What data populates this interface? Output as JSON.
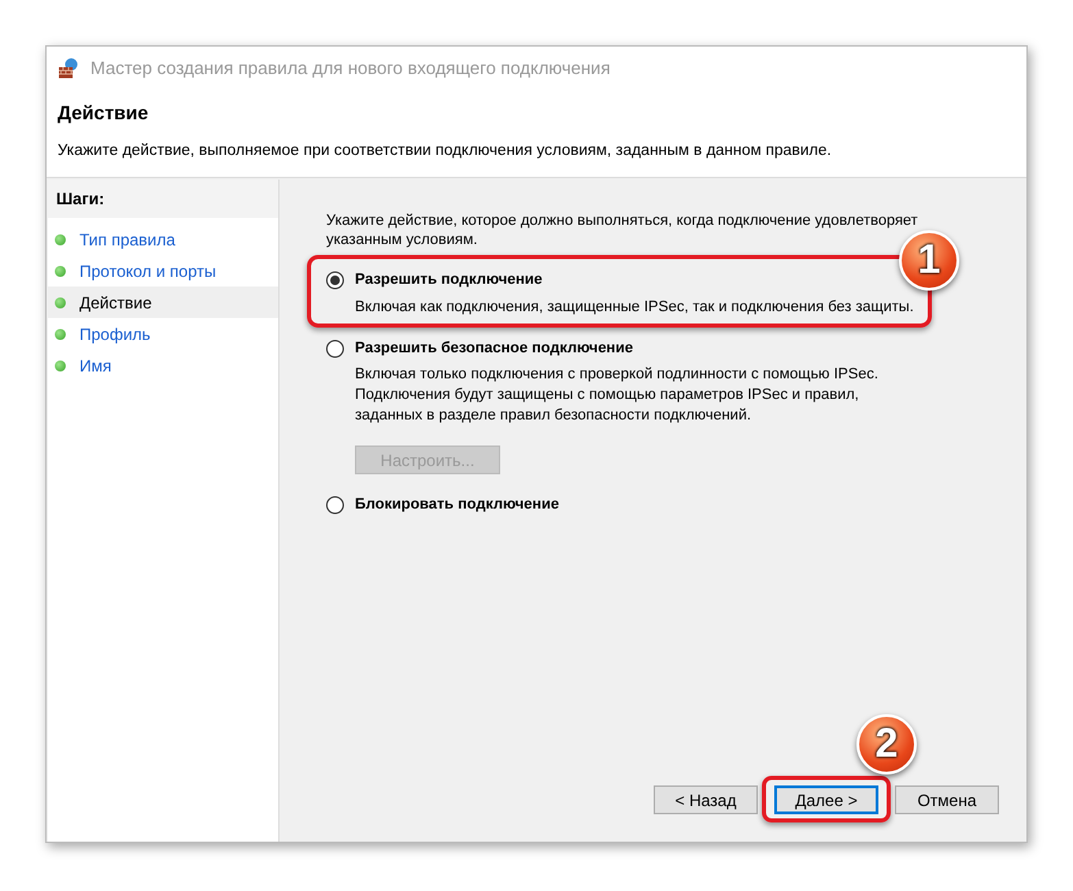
{
  "window": {
    "title": "Мастер создания правила для нового входящего подключения"
  },
  "header": {
    "title": "Действие",
    "subtitle": "Укажите действие, выполняемое при соответствии подключения условиям, заданным в данном правиле."
  },
  "steps": {
    "title": "Шаги:",
    "items": [
      {
        "label": "Тип правила",
        "selected": false
      },
      {
        "label": "Протокол и порты",
        "selected": false
      },
      {
        "label": "Действие",
        "selected": true
      },
      {
        "label": "Профиль",
        "selected": false
      },
      {
        "label": "Имя",
        "selected": false
      }
    ]
  },
  "prompt": "Укажите действие, которое должно выполняться, когда подключение удовлетворяет указанным условиям.",
  "options": [
    {
      "label": "Разрешить подключение",
      "selected": true,
      "description": [
        "Включая как подключения, защищенные IPSec, так и подключения без защиты."
      ],
      "callout": "1"
    },
    {
      "label": "Разрешить безопасное подключение",
      "selected": false,
      "description": [
        "Включая только подключения с проверкой подлинности с помощью IPSec.",
        "Подключения будут защищены с помощью параметров IPSec и правил, заданных в разделе правил безопасности подключений."
      ],
      "button": {
        "label": "Настроить...",
        "disabled": true
      }
    },
    {
      "label": "Блокировать подключение",
      "selected": false
    }
  ],
  "buttons": [
    {
      "label": "< Назад",
      "focused": false
    },
    {
      "label": "Далее >",
      "focused": true,
      "callout": "2"
    },
    {
      "label": "Отмена",
      "focused": false
    }
  ]
}
